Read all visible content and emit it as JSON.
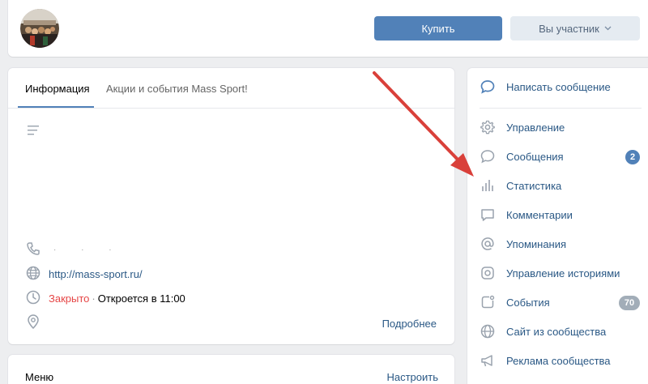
{
  "header": {
    "buy_label": "Купить",
    "member_label": "Вы участник"
  },
  "tabs": [
    {
      "label": "Информация",
      "active": true
    },
    {
      "label": "Акции и события Mass Sport!",
      "active": false
    }
  ],
  "info": {
    "phone": "· · ·",
    "site": "http://mass-sport.ru/",
    "status_closed": "Закрыто",
    "status_separator": "·",
    "status_opens": "Откроется в 11:00",
    "more_label": "Подробнее"
  },
  "menu": {
    "title": "Меню",
    "settings_label": "Настроить"
  },
  "sidebar": {
    "write_message": "Написать сообщение",
    "items": [
      {
        "label": "Управление",
        "icon": "gear-icon"
      },
      {
        "label": "Сообщения",
        "icon": "chat-bubble-icon",
        "badge": "2"
      },
      {
        "label": "Статистика",
        "icon": "bar-chart-icon"
      },
      {
        "label": "Комментарии",
        "icon": "comment-icon"
      },
      {
        "label": "Упоминания",
        "icon": "at-icon"
      },
      {
        "label": "Управление историями",
        "icon": "stories-icon"
      },
      {
        "label": "События",
        "icon": "events-icon",
        "badge": "70"
      },
      {
        "label": "Сайт из сообщества",
        "icon": "globe-icon"
      },
      {
        "label": "Реклама сообщества",
        "icon": "megaphone-icon"
      }
    ]
  },
  "colors": {
    "accent": "#5181b8",
    "link": "#2a5885",
    "closed": "#e64646",
    "arrow": "#d9403a"
  }
}
